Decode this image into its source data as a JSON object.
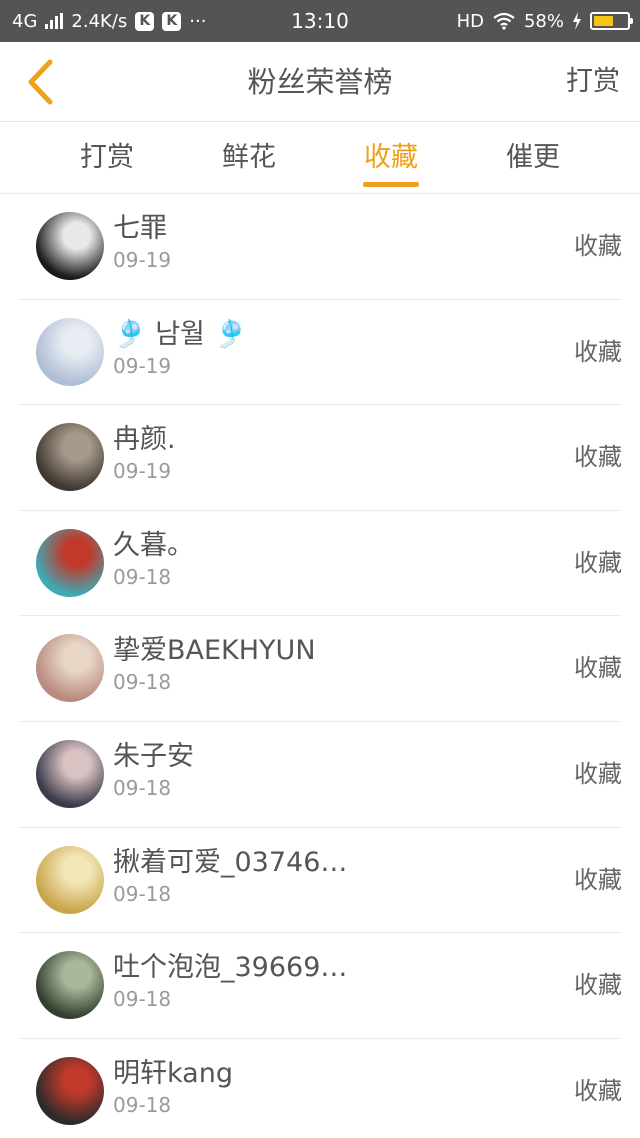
{
  "status_bar": {
    "network": "4G",
    "speed": "2.4K/s",
    "badges": [
      "K",
      "K"
    ],
    "more": "···",
    "time": "13:10",
    "hd": "HD",
    "battery": "58%",
    "battery_level": 0.58,
    "battery_color": "#f5c518"
  },
  "header": {
    "back_icon": "chevron-left-icon",
    "back_color": "#f0a01e",
    "title": "粉丝荣誉榜",
    "action": "打赏"
  },
  "tabs": [
    {
      "label": "打赏",
      "active": false
    },
    {
      "label": "鲜花",
      "active": false
    },
    {
      "label": "收藏",
      "active": true
    },
    {
      "label": "催更",
      "active": false
    }
  ],
  "accent_color": "#f0a01e",
  "list": [
    {
      "name": "七罪",
      "date": "09-19",
      "action": "收藏",
      "avatar_colors": [
        "#1a1a1a",
        "#e8e8e8"
      ]
    },
    {
      "name": "🎐 남월 🎐",
      "date": "09-19",
      "action": "收藏",
      "avatar_colors": [
        "#aebed3",
        "#e9edf3"
      ]
    },
    {
      "name": "冉颜.",
      "date": "09-19",
      "action": "收藏",
      "avatar_colors": [
        "#3e3832",
        "#a89a8a"
      ]
    },
    {
      "name": "久暮。",
      "date": "09-18",
      "action": "收藏",
      "avatar_colors": [
        "#3fa9b5",
        "#c0392b"
      ]
    },
    {
      "name": "挚爱BAEKHYUN",
      "date": "09-18",
      "action": "收藏",
      "avatar_colors": [
        "#b88a80",
        "#e8d6c7"
      ]
    },
    {
      "name": "朱子安",
      "date": "09-18",
      "action": "收藏",
      "avatar_colors": [
        "#3a3a4a",
        "#d9c2c2"
      ]
    },
    {
      "name": "揪着可爱_03746…",
      "date": "09-18",
      "action": "收藏",
      "avatar_colors": [
        "#c9a54a",
        "#f3e7b8"
      ]
    },
    {
      "name": "吐个泡泡_39669…",
      "date": "09-18",
      "action": "收藏",
      "avatar_colors": [
        "#34402e",
        "#a8b89a"
      ]
    },
    {
      "name": "明轩kang",
      "date": "09-18",
      "action": "收藏",
      "avatar_colors": [
        "#2b2b2b",
        "#c0392b"
      ]
    }
  ]
}
